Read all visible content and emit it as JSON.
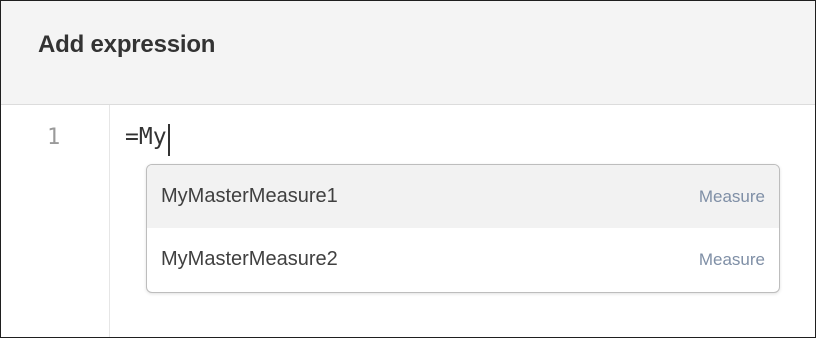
{
  "dialog": {
    "title": "Add expression"
  },
  "editor": {
    "line_number": "1",
    "code": "=My"
  },
  "autocomplete": {
    "items": [
      {
        "label": "MyMasterMeasure1",
        "type": "Measure",
        "highlighted": true
      },
      {
        "label": "MyMasterMeasure2",
        "type": "Measure",
        "highlighted": false
      }
    ]
  },
  "colors": {
    "header_bg": "#f4f4f4",
    "highlight_bg": "#f2f2f2",
    "type_text": "#7f8fa6"
  }
}
